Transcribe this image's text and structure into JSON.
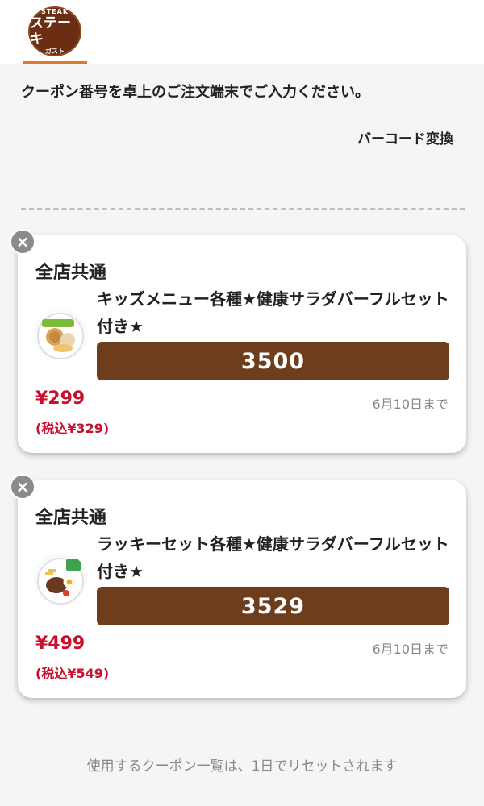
{
  "brand": {
    "logo_top": "STEAK",
    "logo_main": "ステーキ",
    "logo_sub": "ガスト",
    "accent_color": "#e07a2a",
    "brand_color": "#6b2e12"
  },
  "instruction": "クーポン番号を卓上のご注文端末でご入力ください。",
  "barcode_link": "バーコード変換",
  "coupons": [
    {
      "store": "全店共通",
      "name": "キッズメニュー各種★健康サラダバーフルセット付き★",
      "code": "3500",
      "price": "¥299",
      "tax_price": "(税込¥329)",
      "expiry": "6月10日まで",
      "thumb_icon": "kids-plate-icon"
    },
    {
      "store": "全店共通",
      "name": "ラッキーセット各種★健康サラダバーフルセット付き★",
      "code": "3529",
      "price": "¥499",
      "tax_price": "(税込¥549)",
      "expiry": "6月10日まで",
      "thumb_icon": "hamburg-plate-icon"
    }
  ],
  "close_symbol": "×",
  "footer_note": "使用するクーポン一覧は、1日でリセットされます",
  "colors": {
    "code_bar": "#6e3d1c",
    "price": "#c8102e",
    "close_button": "#8b8b8b"
  }
}
